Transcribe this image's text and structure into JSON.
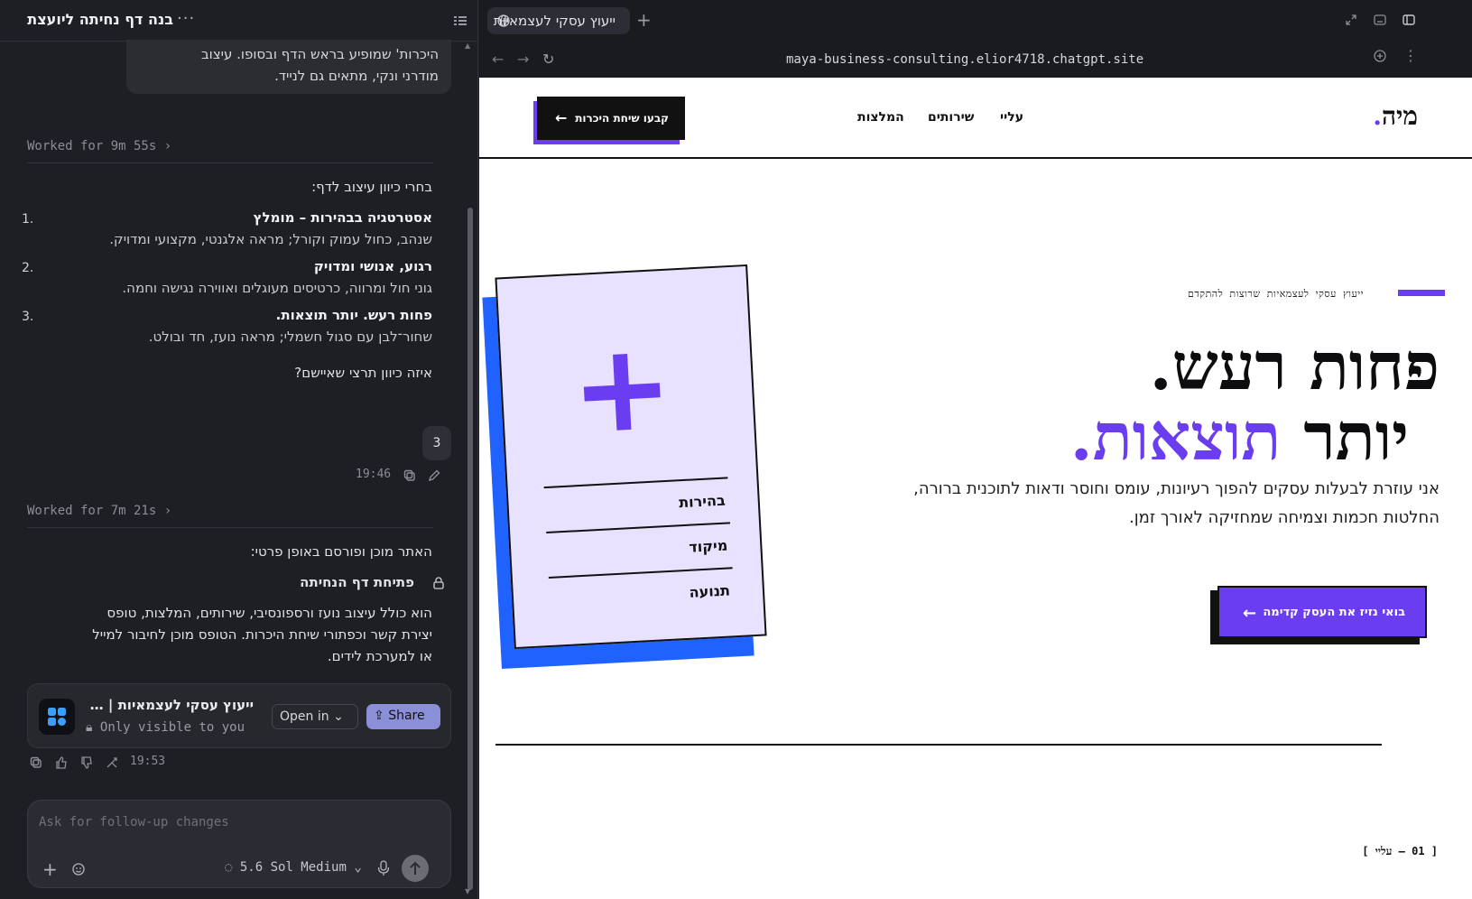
{
  "chat": {
    "title": "בנה דף נחיתה ליועצת",
    "top_bubble": [
      "היכרות' שמופיע בראש הדף ובסופו. עיצוב",
      "מודרני ונקי, מתאים גם לנייד."
    ],
    "worked1": "Worked for 9m 55s",
    "intro": "בחרי כיוון עיצוב לדף:",
    "options": [
      {
        "num": "1.",
        "title": "אסטרטגיה בבהירות – מומלץ",
        "desc": "שנהב, כחול עמוק וקורל; מראה אלגנטי, מקצועי ומדויק."
      },
      {
        "num": "2.",
        "title": "רגוע, אנושי ומדויק",
        "desc": "גוני חול ומרווה, כרטיסים מעוגלים ואווירה נגישה וחמה."
      },
      {
        "num": "3.",
        "title": "פחות רעש. יותר תוצאות.",
        "desc": "שחור־לבן עם סגול חשמלי; מראה נועז, חד ובולט."
      }
    ],
    "question": "איזה כיוון תרצי שאיישם?",
    "user_reply": "3",
    "user_time": "19:46",
    "worked2": "Worked for 7m 21s",
    "ready": "האתר מוכן ופורסם באופן פרטי:",
    "open_link": "פתיחת דף הנחיתה",
    "summary": [
      "הוא כולל עיצוב נועז ורספונסיבי, שירותים, המלצות, טופס",
      "יצירת קשר וכפתורי שיחת היכרות. הטופס מוכן לחיבור למייל",
      "או למערכת לידים."
    ],
    "card": {
      "title": "ייעוץ עסקי לעצמאיות | …",
      "visibility": "Only visible to you",
      "open_label": "Open in",
      "share_label": "Share"
    },
    "reply_time": "19:53",
    "compose": {
      "placeholder": "Ask for follow-up changes",
      "model": "5.6 Sol Medium"
    }
  },
  "browser": {
    "tab_title": "ייעוץ עסקי לעצמאיות",
    "url": "maya-business-consulting.elior4718.chatgpt.site"
  },
  "site": {
    "logo": "מיה",
    "logo_dot": ".",
    "nav": [
      "עליי",
      "שירותים",
      "המלצות"
    ],
    "cta_top": "קבעו שיחת היכרות",
    "eyebrow": "ייעוץ עסקי לעצמאיות שרוצות להתקדם",
    "hero_line1": "פחות רעש.",
    "hero_line2_plain": "יותר ",
    "hero_line2_accent": "תוצאות.",
    "hero_desc": "אני עוזרת לבעלות עסקים להפוך רעיונות, עומס וחוסר ודאות לתוכנית ברורה, החלטות חכמות וצמיחה שמחזיקה לאורך זמן.",
    "cta_main": "בואי נזיז את העסק קדימה",
    "card_words": [
      "בהירות",
      "מיקוד",
      "תנועה"
    ],
    "pager": "[ 01 — עליי ]"
  },
  "colors": {
    "accent": "#6b3df0",
    "card_blue": "#1f62ff",
    "card_lilac": "#e8e2ff",
    "chat_bg": "#1e1f24"
  }
}
